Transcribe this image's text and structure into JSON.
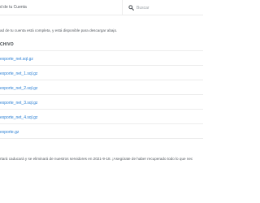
{
  "header": {
    "breadcrumb": "d de tu Cuenta",
    "search_placeholder": "Buscar"
  },
  "main": {
    "status_text": "ad de tu cuenta está completa, y está disponible para descargar abajo.",
    "section_heading": "CHIVO",
    "files": [
      {
        "name": "exporte_net.sql.gz"
      },
      {
        "name": "exporte_net_1.sql.gz"
      },
      {
        "name": "exporte_net_2.sql.gz"
      },
      {
        "name": "exporte_net_3.sql.gz"
      },
      {
        "name": "exporte_net_4.sql.gz"
      },
      {
        "name": "exporte.gz"
      }
    ],
    "expiry_note": "rtará caducará y se eliminará de nuestros servidores en 2021-9-18. ¡Asegúrate de haber recuperado todo lo que nec"
  },
  "colors": {
    "link": "#2a7fd4",
    "text": "#555a60",
    "divider": "#ececec"
  }
}
